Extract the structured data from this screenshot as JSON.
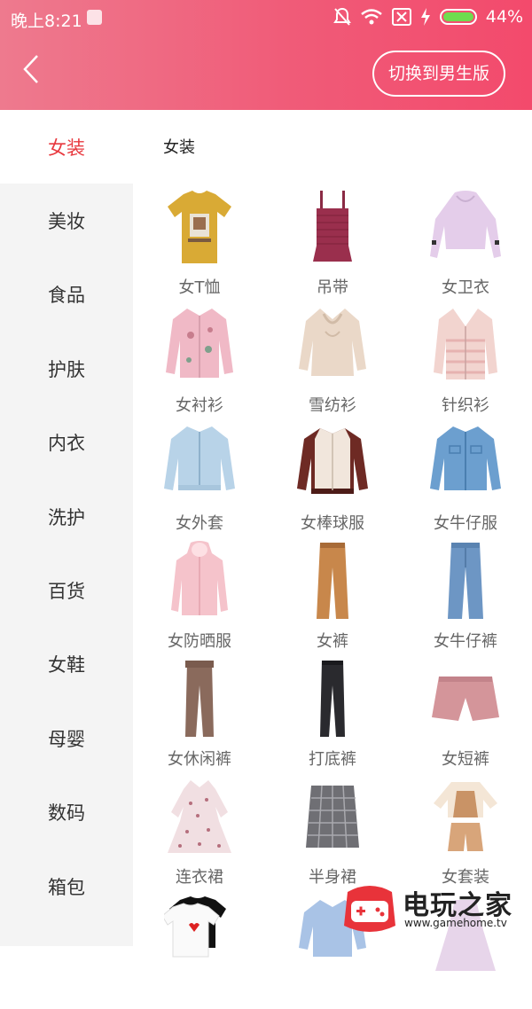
{
  "status_bar": {
    "time": "晚上8:21",
    "battery": "44%",
    "battery_level": 0.44
  },
  "header": {
    "back_icon": "chevron-left-icon",
    "switch_label": "切换到男生版"
  },
  "sidebar": {
    "items": [
      {
        "label": "女装",
        "active": true
      },
      {
        "label": "美妆"
      },
      {
        "label": "食品"
      },
      {
        "label": "护肤"
      },
      {
        "label": "内衣"
      },
      {
        "label": "洗护"
      },
      {
        "label": "百货"
      },
      {
        "label": "女鞋"
      },
      {
        "label": "母婴"
      },
      {
        "label": "数码"
      },
      {
        "label": "箱包"
      }
    ]
  },
  "main": {
    "section_title": "女装",
    "categories": [
      {
        "label": "女T恤",
        "icon": "tshirt"
      },
      {
        "label": "吊带",
        "icon": "camisole"
      },
      {
        "label": "女卫衣",
        "icon": "hoodie"
      },
      {
        "label": "女衬衫",
        "icon": "shirt"
      },
      {
        "label": "雪纺衫",
        "icon": "chiffon"
      },
      {
        "label": "针织衫",
        "icon": "cardigan"
      },
      {
        "label": "女外套",
        "icon": "coat"
      },
      {
        "label": "女棒球服",
        "icon": "baseball-jacket"
      },
      {
        "label": "女牛仔服",
        "icon": "denim-jacket"
      },
      {
        "label": "女防晒服",
        "icon": "sun-jacket"
      },
      {
        "label": "女裤",
        "icon": "trousers"
      },
      {
        "label": "女牛仔裤",
        "icon": "jeans"
      },
      {
        "label": "女休闲裤",
        "icon": "casual-pants"
      },
      {
        "label": "打底裤",
        "icon": "leggings"
      },
      {
        "label": "女短裤",
        "icon": "shorts"
      },
      {
        "label": "连衣裙",
        "icon": "dress"
      },
      {
        "label": "半身裙",
        "icon": "skirt"
      },
      {
        "label": "女套装",
        "icon": "set"
      }
    ]
  },
  "watermark": {
    "name": "电玩之家",
    "url": "www.gamehome.tv"
  }
}
